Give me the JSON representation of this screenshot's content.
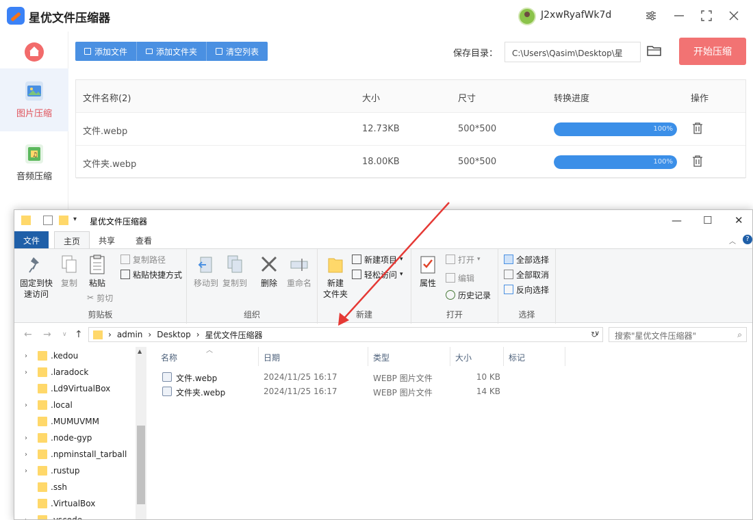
{
  "app": {
    "title": "星优文件压缩器",
    "username": "J2xwRyafWk7d",
    "sidebar": [
      {
        "label": "图片压缩",
        "active": true
      },
      {
        "label": "音频压缩",
        "active": false
      }
    ],
    "toolbar": {
      "add_file": "添加文件",
      "add_folder": "添加文件夹",
      "clear_list": "清空列表"
    },
    "save_dir_label": "保存目录：",
    "save_dir_path": "C:\\Users\\Qasim\\Desktop\\星",
    "start_button": "开始压缩",
    "table": {
      "headers": [
        "文件名称(2)",
        "大小",
        "尺寸",
        "转换进度",
        "操作"
      ],
      "rows": [
        {
          "name": "文件.webp",
          "size": "12.73KB",
          "dims": "500*500",
          "progress": 100,
          "progress_text": "100%"
        },
        {
          "name": "文件夹.webp",
          "size": "18.00KB",
          "dims": "500*500",
          "progress": 100,
          "progress_text": "100%"
        }
      ]
    },
    "colors": {
      "primary": "#4a90e2",
      "start": "#f27373",
      "progress": "#3b8fe8"
    }
  },
  "explorer": {
    "title": "星优文件压缩器",
    "tabs": [
      "文件",
      "主页",
      "共享",
      "查看"
    ],
    "ribbon": {
      "clipboard": {
        "label": "剪贴板",
        "pin": "固定到快\n速访问",
        "pin_l1": "固定到快",
        "pin_l2": "速访问",
        "copy": "复制",
        "paste": "粘贴",
        "copy_path": "复制路径",
        "paste_shortcut": "粘贴快捷方式",
        "cut": "剪切"
      },
      "organize": {
        "label": "组织",
        "move_to": "移动到",
        "copy_to": "复制到",
        "delete": "删除",
        "rename": "重命名"
      },
      "new": {
        "label": "新建",
        "new_folder_l1": "新建",
        "new_folder_l2": "文件夹",
        "new_item": "新建项目",
        "easy_access": "轻松访问"
      },
      "open": {
        "label": "打开",
        "properties": "属性",
        "open": "打开",
        "edit": "编辑",
        "history": "历史记录"
      },
      "select": {
        "label": "选择",
        "select_all": "全部选择",
        "select_none": "全部取消",
        "invert": "反向选择"
      }
    },
    "breadcrumb": [
      "admin",
      "Desktop",
      "星优文件压缩器"
    ],
    "search_placeholder": "搜索\"星优文件压缩器\"",
    "tree": [
      ".kedou",
      ".laradock",
      ".Ld9VirtualBox",
      ".local",
      ".MUMUVMM",
      ".node-gyp",
      ".npminstall_tarball",
      ".rustup",
      ".ssh",
      ".VirtualBox",
      ".vscode"
    ],
    "tree_has_chevron": [
      true,
      true,
      false,
      true,
      false,
      true,
      true,
      true,
      false,
      false,
      true
    ],
    "columns": [
      "名称",
      "日期",
      "类型",
      "大小",
      "标记"
    ],
    "files": [
      {
        "name": "文件.webp",
        "date": "2024/11/25 16:17",
        "type": "WEBP 图片文件",
        "size": "10 KB"
      },
      {
        "name": "文件夹.webp",
        "date": "2024/11/25 16:17",
        "type": "WEBP 图片文件",
        "size": "14 KB"
      }
    ]
  }
}
